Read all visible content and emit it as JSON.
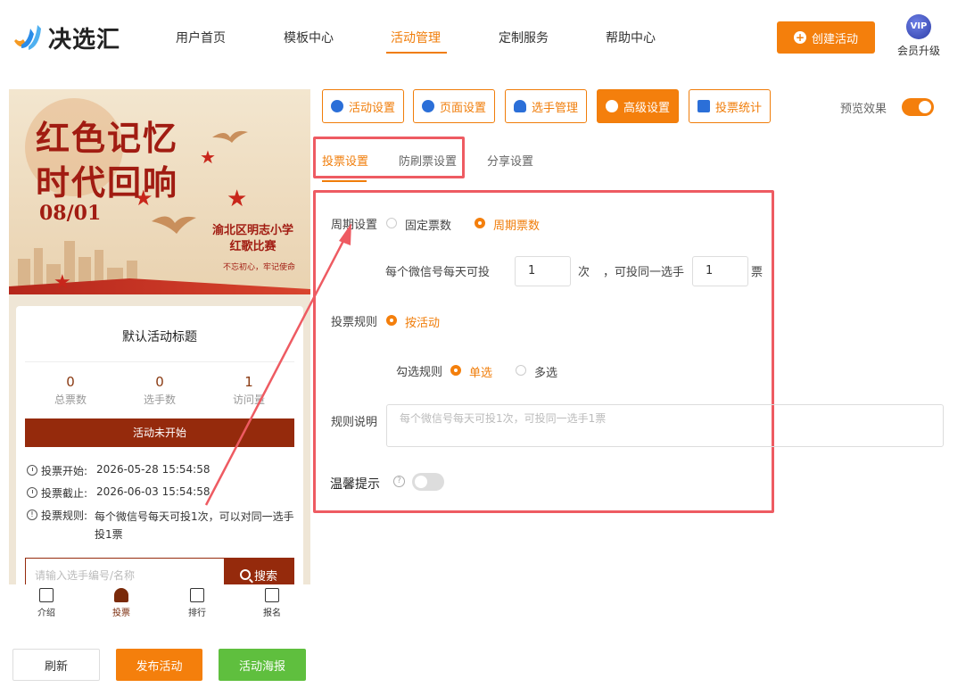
{
  "app": {
    "brand": "决选汇"
  },
  "nav": [
    {
      "label": "用户首页"
    },
    {
      "label": "模板中心"
    },
    {
      "label": "活动管理"
    },
    {
      "label": "定制服务"
    },
    {
      "label": "帮助中心"
    }
  ],
  "header": {
    "create_label": "创建活动",
    "vip_badge": "VIP",
    "vip_label": "会员升级"
  },
  "poster": {
    "title_line1": "红色记忆",
    "title_line2": "时代回响",
    "date": "08/01",
    "school_line1": "渝北区明志小学",
    "school_line2": "红歌比赛",
    "slogan": "不忘初心，牢记使命"
  },
  "activity": {
    "title": "默认活动标题",
    "stats": [
      {
        "value": "0",
        "label": "总票数"
      },
      {
        "value": "0",
        "label": "选手数"
      },
      {
        "value": "1",
        "label": "访问量"
      }
    ],
    "status": "活动未开始",
    "start_label": "投票开始:",
    "start_value": "2026-05-28 15:54:58",
    "end_label": "投票截止:",
    "end_value": "2026-06-03 15:54:58",
    "rule_label": "投票规则:",
    "rule_value": "每个微信号每天可投1次，可以对同一选手投1票",
    "search_placeholder": "请输入选手编号/名称",
    "search_button": "搜索"
  },
  "tabbar": [
    {
      "label": "介绍"
    },
    {
      "label": "投票"
    },
    {
      "label": "排行"
    },
    {
      "label": "报名"
    }
  ],
  "actions": {
    "refresh": "刷新",
    "publish": "发布活动",
    "poster": "活动海报"
  },
  "settings_tabs": [
    {
      "label": "活动设置"
    },
    {
      "label": "页面设置"
    },
    {
      "label": "选手管理"
    },
    {
      "label": "高级设置"
    },
    {
      "label": "投票统计"
    }
  ],
  "preview_toggle": {
    "label": "预览效果",
    "on": true
  },
  "subtabs": [
    {
      "label": "投票设置"
    },
    {
      "label": "防刷票设置"
    },
    {
      "label": "分享设置"
    }
  ],
  "form": {
    "period_label": "周期设置",
    "period_options": [
      {
        "label": "固定票数"
      },
      {
        "label": "周期票数"
      }
    ],
    "per_wechat_label": "每个微信号每天可投",
    "times_value": "1",
    "times_unit": "次",
    "same_player_label": "，可投同一选手",
    "votes_value": "1",
    "votes_unit": "票",
    "vote_rule_label": "投票规则",
    "vote_rule_option": "按活动",
    "check_rule_label": "勾选规则",
    "check_options": [
      {
        "label": "单选"
      },
      {
        "label": "多选"
      }
    ],
    "rule_desc_label": "规则说明",
    "rule_desc_placeholder": "每个微信号每天可投1次，可投同一选手1票",
    "tip_label": "温馨提示",
    "help_glyph": "?"
  },
  "colors": {
    "accent": "#f47f0c",
    "highlight": "#ee5b62",
    "brown": "#952a0c",
    "green": "#5fbf3e"
  }
}
